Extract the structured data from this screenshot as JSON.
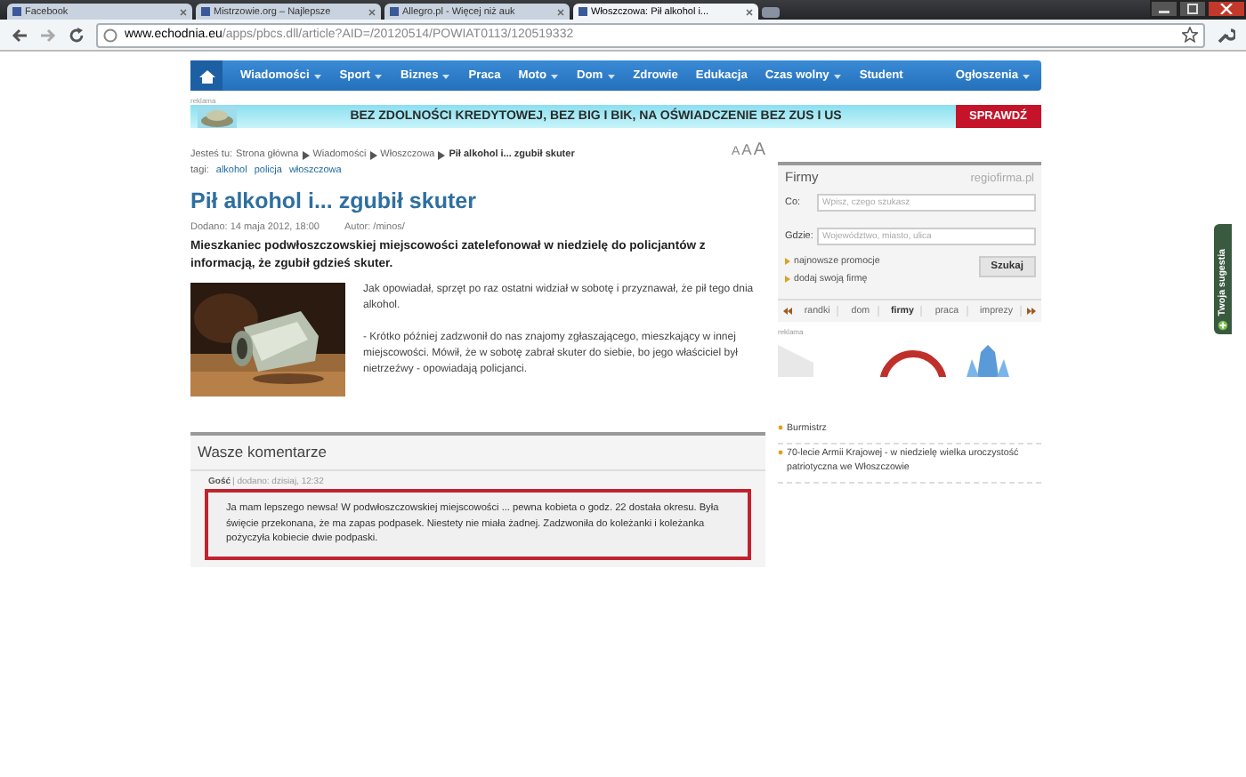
{
  "browser": {
    "tabs": [
      {
        "title": "Facebook",
        "selected": false
      },
      {
        "title": "Mistrzowie.org – Najlepsze",
        "selected": false
      },
      {
        "title": "Allegro.pl - Więcej niż auk",
        "selected": false
      },
      {
        "title": "Włoszczowa: Pił alkohol i...",
        "selected": true
      }
    ],
    "url_host": "www.echodnia.eu",
    "url_path": "/apps/pbcs.dll/article?AID=/20120514/POWIAT0113/120519332"
  },
  "nav": {
    "items": [
      {
        "label": "Wiadomości",
        "has_menu": true
      },
      {
        "label": "Sport",
        "has_menu": true
      },
      {
        "label": "Biznes",
        "has_menu": true
      },
      {
        "label": "Praca",
        "has_menu": false
      },
      {
        "label": "Moto",
        "has_menu": true
      },
      {
        "label": "Dom",
        "has_menu": true
      },
      {
        "label": "Zdrowie",
        "has_menu": false
      },
      {
        "label": "Edukacja",
        "has_menu": false
      },
      {
        "label": "Czas wolny",
        "has_menu": true
      },
      {
        "label": "Student",
        "has_menu": false
      }
    ],
    "right_item": {
      "label": "Ogłoszenia",
      "has_menu": true
    }
  },
  "banner": {
    "label": "reklama",
    "text": "BEZ ZDOLNOŚCI KREDYTOWEJ, BEZ BIG I BIK, NA OŚWIADCZENIE BEZ ZUS I US",
    "button": "SPRAWDŹ"
  },
  "breadcrumb": {
    "intro": "Jesteś tu:",
    "items": [
      {
        "label": "Strona główna",
        "current": false
      },
      {
        "label": "Wiadomości",
        "current": false
      },
      {
        "label": "Włoszczowa",
        "current": false
      },
      {
        "label": "Pił alkohol i... zgubił skuter",
        "current": true
      }
    ]
  },
  "tags": {
    "label": "tagi:",
    "items": [
      "alkohol",
      "policja",
      "włoszczowa"
    ]
  },
  "font_sizes": [
    "A",
    "A",
    "A"
  ],
  "article": {
    "title": "Pił alkohol i... zgubił skuter",
    "date": "Dodano: 14 maja 2012, 18:00",
    "author": "Autor: /minos/",
    "lead": "Mieszkaniec podwłoszczowskiej miejscowości zatelefonował w niedzielę do policjantów z informacją, że zgubił gdzieś skuter.",
    "paragraphs": [
      "Jak opowiadał, sprzęt po raz ostatni widział w sobotę i przyznawał, że pił tego dnia alkohol.",
      "- Krótko później zadzwonił do nas znajomy zgłaszającego, mieszkający w innej miejscowości. Mówił, że w sobotę zabrał skuter do siebie, bo jego właściciel był nietrzeźwy - opowiadają policjanci."
    ]
  },
  "comments": {
    "title": "Wasze komentarze",
    "items": [
      {
        "author": "Gość",
        "meta": "| dodano: dzisiaj, 12:32",
        "text": "Ja mam lepszego newsa! W podwłoszczowskiej miejscowości ... pewna kobieta o godz. 22 dostała okresu. Była święcie przekonana, że ma zapas podpasek. Niestety nie miała żadnej. Zadzwoniła do koleżanki i koleżanka pożyczyła kobiecie dwie podpaski."
      }
    ]
  },
  "firmy": {
    "title": "Firmy",
    "logo": "regiofirma.pl",
    "fields": [
      {
        "label": "Co:",
        "placeholder": "Wpisz, czego szukasz"
      },
      {
        "label": "Gdzie:",
        "placeholder": "Województwo, miasto, ulica"
      }
    ],
    "links": [
      "najnowsze promocje",
      "dodaj swoją firmę"
    ],
    "button": "Szukaj",
    "tabs": [
      {
        "label": "randki",
        "selected": false
      },
      {
        "label": "dom",
        "selected": false
      },
      {
        "label": "firmy",
        "selected": true
      },
      {
        "label": "praca",
        "selected": false
      },
      {
        "label": "imprezy",
        "selected": false
      }
    ]
  },
  "sidebar_ad": {
    "label": "reklama",
    "kind": "picture"
  },
  "sidebar_list": [
    "Burmistrz",
    "70-lecie Armii Krajowej - w niedzielę wielka uroczystość patriotyczna we Włoszczowie"
  ],
  "feedback_tab": "Twoja sugestia"
}
